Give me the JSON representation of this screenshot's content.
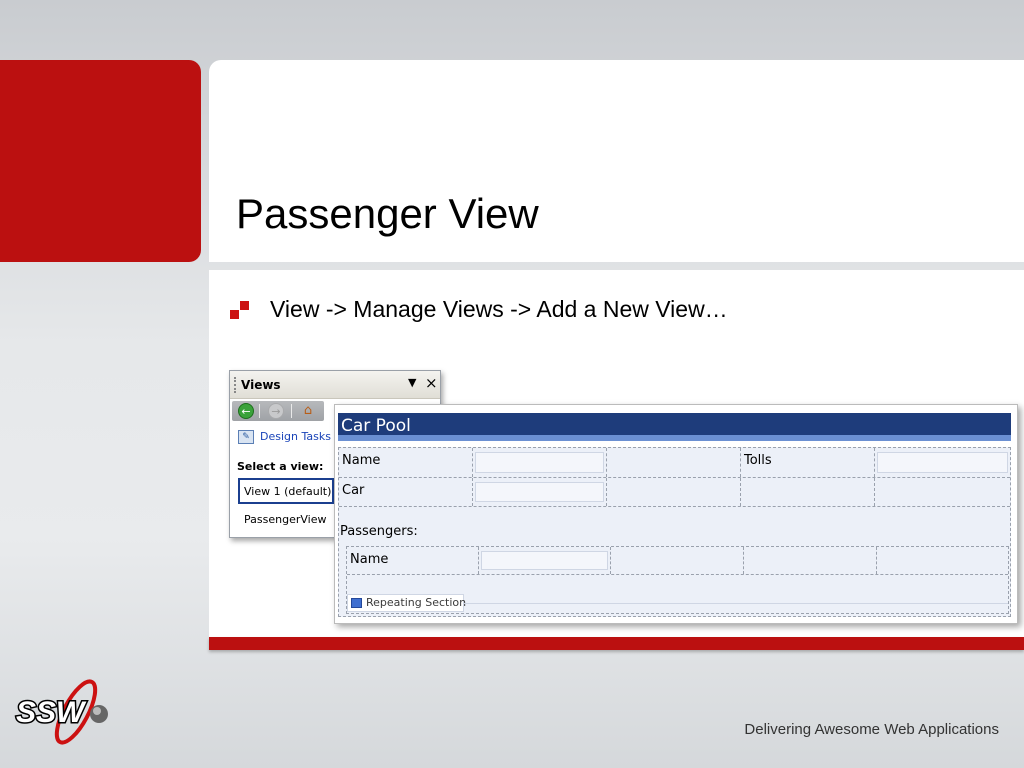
{
  "slide": {
    "title": "Passenger View",
    "bullet": "View -> Manage Views -> Add a New View…"
  },
  "views_pane": {
    "title": "Views",
    "design_tasks": "Design Tasks",
    "select_label": "Select a view:",
    "views": [
      "View 1 (default)",
      "PassengerView"
    ]
  },
  "form": {
    "title": "Car Pool",
    "fields": {
      "name": "Name",
      "tolls": "Tolls",
      "car": "Car",
      "passengers": "Passengers:",
      "passenger_name": "Name"
    },
    "repeating_section": "Repeating Section"
  },
  "footer": {
    "tagline": "Delivering Awesome Web Applications",
    "logo_text": "SSW"
  },
  "colors": {
    "accent_red": "#bb1010",
    "form_header": "#1e3c7b",
    "form_header_stripe": "#6a8fd2"
  }
}
